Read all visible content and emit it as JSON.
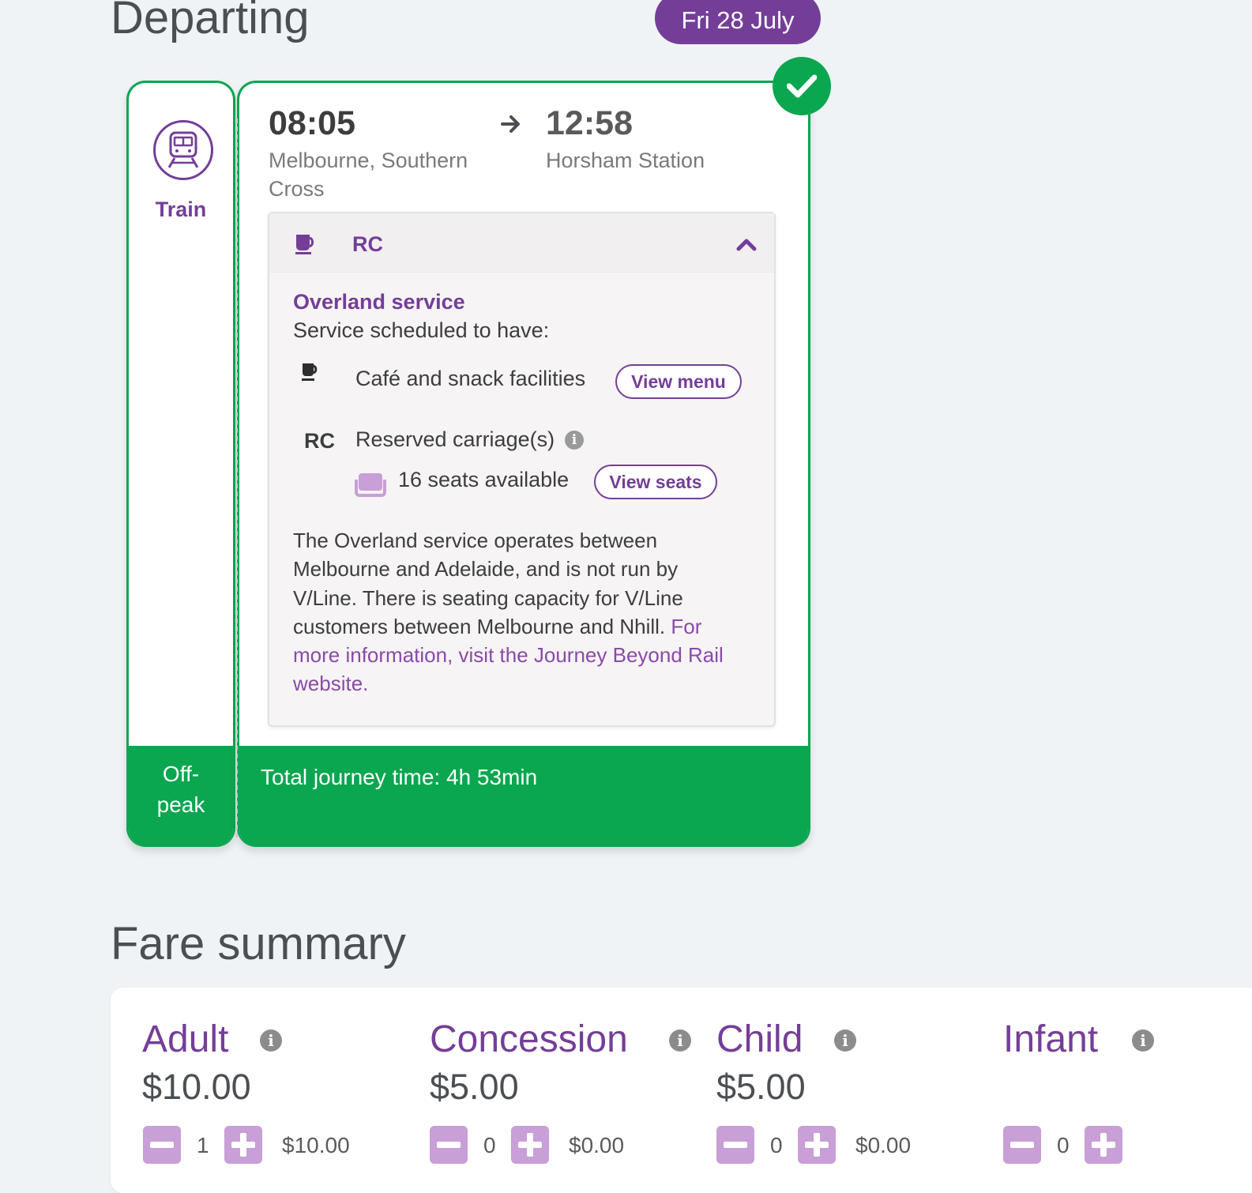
{
  "departing": {
    "heading": "Departing",
    "date": "Fri 28 July"
  },
  "journey": {
    "mode_label": "Train",
    "depart_time": "08:05",
    "depart_station_line1": "Melbourne, Southern",
    "depart_station_line2": "Cross",
    "arrive_time": "12:58",
    "arrive_station": "Horsham Station",
    "fare_type_line1": "Off-",
    "fare_type_line2": "peak",
    "total_time": "Total journey time: 4h 53min",
    "selected": true
  },
  "service": {
    "code": "RC",
    "title": "Overland service",
    "scheduled": "Service scheduled to have:",
    "cafe_label": "Café and snack facilities",
    "view_menu": "View menu",
    "rc_label": "RC",
    "reserved_label": "Reserved carriage(s)",
    "seats_available": "16 seats available",
    "view_seats": "View seats",
    "description_lines": [
      "The Overland service operates between",
      "Melbourne and Adelaide, and is not run by",
      "V/Line. There is seating capacity for V/Line",
      "customers between Melbourne and Nhill. "
    ],
    "link_part1": "For",
    "link_part2": "more information, visit the Journey Beyond Rail",
    "link_part3": "website."
  },
  "fare_summary": {
    "heading": "Fare summary",
    "fares": [
      {
        "name": "Adult",
        "price": "$10.00",
        "qty": "1",
        "subtotal": "$10.00"
      },
      {
        "name": "Concession",
        "price": "$5.00",
        "qty": "0",
        "subtotal": "$0.00"
      },
      {
        "name": "Child",
        "price": "$5.00",
        "qty": "0",
        "subtotal": "$0.00"
      },
      {
        "name": "Infant",
        "price": "",
        "qty": "0",
        "subtotal": ""
      }
    ]
  },
  "colors": {
    "brand_purple": "#743e98",
    "success_green": "#0aa650",
    "stepper_purple": "#c89fd6"
  },
  "icons": [
    "train-icon",
    "check-icon",
    "coffee-cup-icon",
    "chevron-up-icon",
    "info-icon",
    "seat-icon",
    "minus-icon",
    "plus-icon",
    "right-arrow-icon"
  ]
}
